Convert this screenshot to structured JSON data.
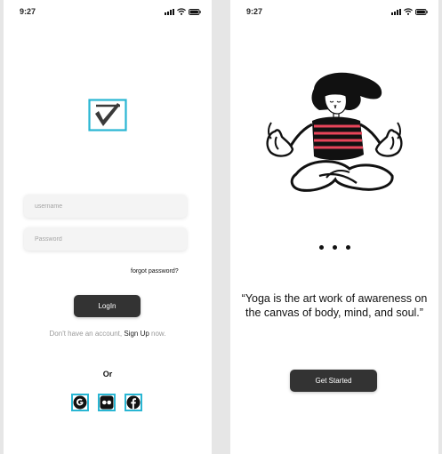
{
  "status_bar": {
    "time": "9:27"
  },
  "login": {
    "username_placeholder": "username",
    "password_placeholder": "Password",
    "forgot_label": "forgot password?",
    "login_label": "LogIn",
    "signup_prefix": "Don't have an account, ",
    "signup_link": "Sign Up",
    "signup_suffix": " now.",
    "or_label": "Or",
    "social": [
      {
        "name": "google",
        "icon": "google-icon"
      },
      {
        "name": "flickr",
        "icon": "flickr-icon"
      },
      {
        "name": "facebook",
        "icon": "facebook-icon"
      }
    ]
  },
  "onboarding": {
    "page_dots": 3,
    "quote": "“Yoga is the art work of awareness on the canvas of body, mind, and soul.”",
    "get_started_label": "Get Started"
  },
  "colors": {
    "accent": "#29b6d3",
    "button_dark": "#333333",
    "stripe_red": "#e8455a",
    "background": "#e6e6e6"
  }
}
